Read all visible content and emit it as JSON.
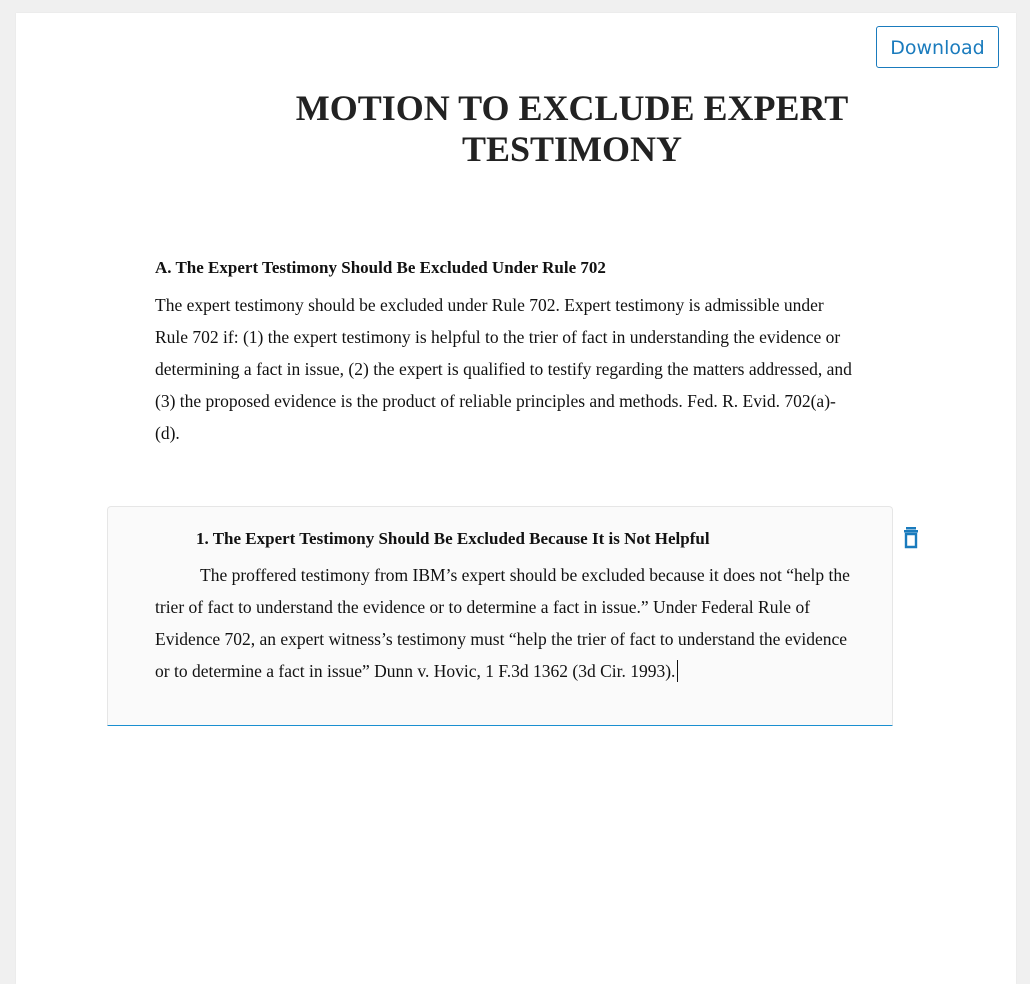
{
  "toolbar": {
    "download_label": "Download"
  },
  "document": {
    "title": "MOTION TO EXCLUDE EXPERT TESTIMONY",
    "section_a": {
      "heading": "A. The Expert Testimony Should Be Excluded Under Rule 702",
      "body": "The expert testimony should be excluded under Rule 702. Expert testimony is admissible under Rule 702 if: (1) the expert testimony is helpful to the trier of fact in understanding the evidence or determining a fact in issue, (2) the expert is qualified to testify regarding the matters addressed, and (3) the proposed evidence is the product of reliable principles and methods. Fed. R. Evid. 702(a)-(d)."
    },
    "section_1": {
      "heading": "1. The Expert Testimony Should Be Excluded Because It is Not Helpful",
      "body": "The proffered testimony from IBM’s expert should be excluded because it does not “help the trier of fact to understand the evidence or to determine a fact in issue.” Under Federal Rule of Evidence 702, an expert witness’s testimony must “help the trier of fact to understand the evidence or to determine a fact in issue” Dunn v. Hovic, 1 F.3d 1362 (3d Cir. 1993)."
    }
  },
  "icons": {
    "delete": "trash-icon"
  },
  "colors": {
    "accent": "#1a7bbd",
    "active_border": "#1a8fd0",
    "block_background": "#fafafa"
  }
}
